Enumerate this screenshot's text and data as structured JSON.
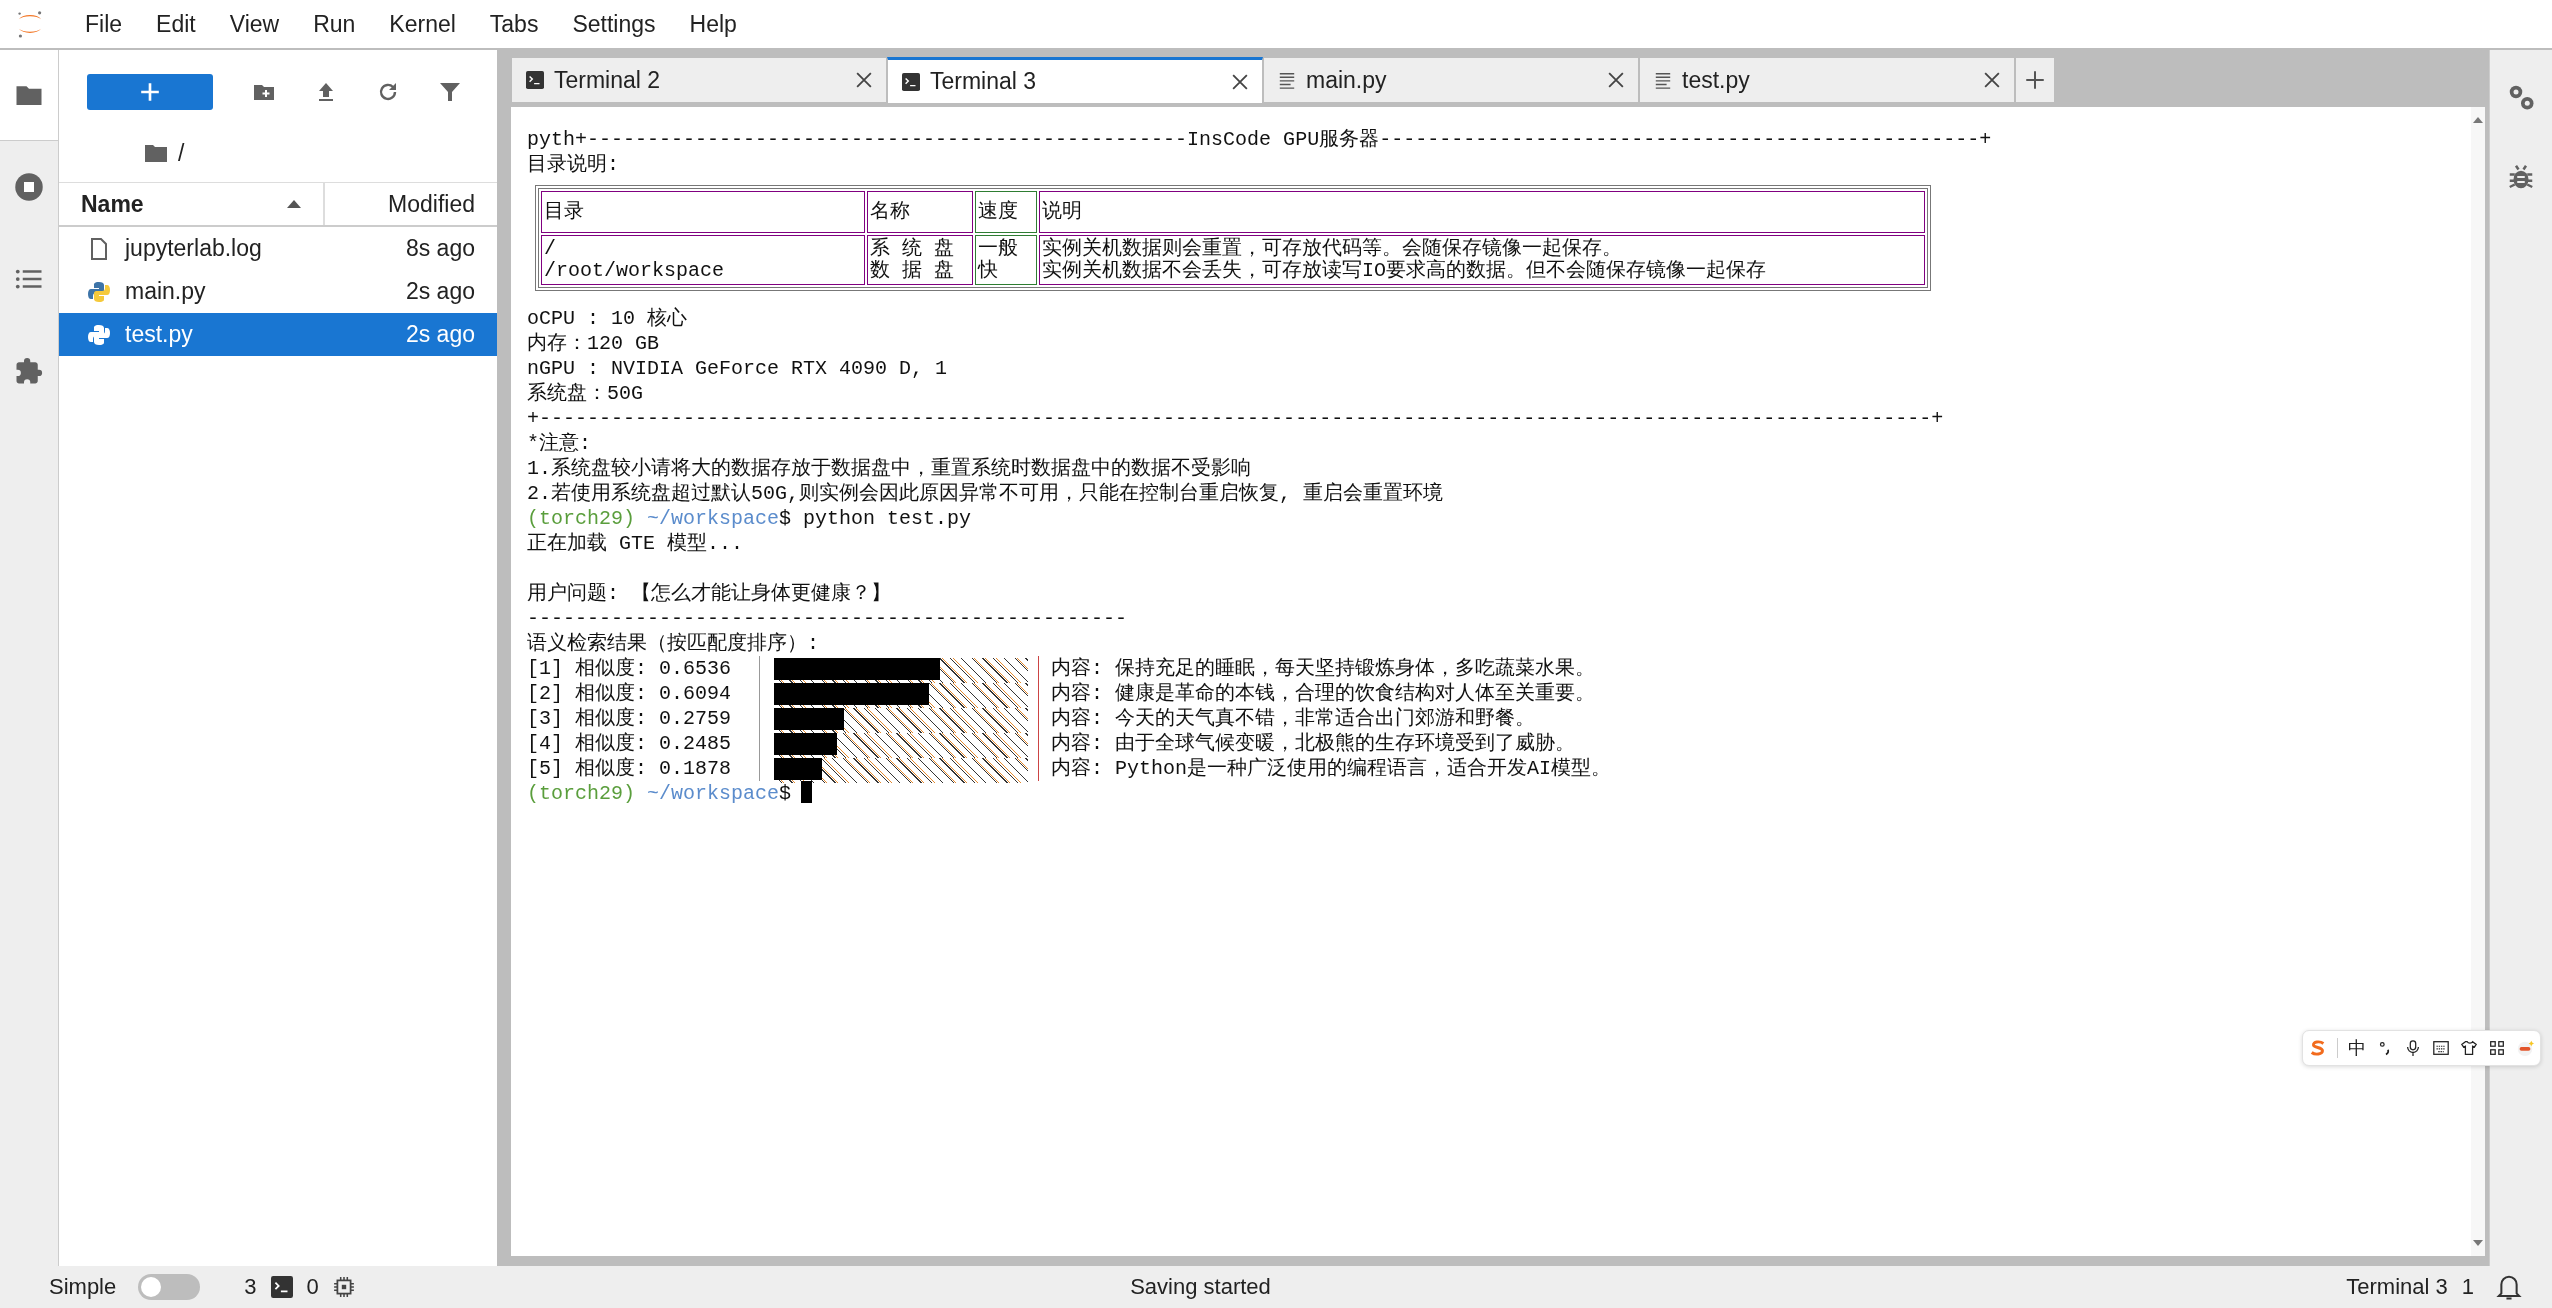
{
  "menu": [
    "File",
    "Edit",
    "View",
    "Run",
    "Kernel",
    "Tabs",
    "Settings",
    "Help"
  ],
  "activity": [
    {
      "kind": "folder",
      "selected": true
    },
    {
      "kind": "stop",
      "selected": false
    },
    {
      "kind": "list",
      "selected": false
    },
    {
      "kind": "puzzle",
      "selected": false
    }
  ],
  "file_browser": {
    "breadcrumb": "/",
    "columns": {
      "name": "Name",
      "modified": "Modified"
    },
    "files": [
      {
        "kind": "log",
        "name": "jupyterlab.log",
        "modified": "8s ago",
        "selected": false
      },
      {
        "kind": "python",
        "name": "main.py",
        "modified": "2s ago",
        "selected": false
      },
      {
        "kind": "python",
        "name": "test.py",
        "modified": "2s ago",
        "selected": true
      }
    ]
  },
  "tabs": [
    {
      "kind": "terminal",
      "label": "Terminal 2",
      "selected": false
    },
    {
      "kind": "terminal",
      "label": "Terminal 3",
      "selected": true
    },
    {
      "kind": "file",
      "label": "main.py",
      "selected": false
    },
    {
      "kind": "file",
      "label": "test.py",
      "selected": false
    }
  ],
  "terminal": {
    "lines": [
      {
        "kind": "text",
        "text": "pyth+--------------------------------------------------InsCode GPU服务器--------------------------------------------------+"
      },
      {
        "kind": "text",
        "text": "目录说明:"
      },
      {
        "kind": "table",
        "columns": [
          "目录",
          "名称",
          "速度",
          "说明"
        ],
        "rows": [
          [
            [
              "/",
              "/root/workspace"
            ],
            [
              "系 统 盘",
              "数 据 盘"
            ],
            [
              "一般",
              "快"
            ],
            [
              "实例关机数据则会重置，可存放代码等。会随保存镜像一起保存。",
              "实例关机数据不会丢失，可存放读写IO要求高的数据。但不会随保存镜像一起保存"
            ]
          ]
        ]
      },
      {
        "kind": "text",
        "text": "oCPU : 10 核心"
      },
      {
        "kind": "text",
        "text": "内存：120 GB"
      },
      {
        "kind": "text",
        "text": "nGPU : NVIDIA GeForce RTX 4090 D, 1"
      },
      {
        "kind": "text",
        "text": "系统盘：50G"
      },
      {
        "kind": "text",
        "text": "+--------------------------------------------------------------------------------------------------------------------+"
      },
      {
        "kind": "text",
        "text": "*注意:"
      },
      {
        "kind": "text",
        "text": "1.系统盘较小请将大的数据存放于数据盘中，重置系统时数据盘中的数据不受影响"
      },
      {
        "kind": "text",
        "text": "2.若使用系统盘超过默认50G,则实例会因此原因异常不可用，只能在控制台重启恢复, 重启会重置环境"
      },
      {
        "kind": "prompt",
        "env": "(torch29)",
        "path": "~/workspace",
        "command": "$ python test.py",
        "cursor": false
      },
      {
        "kind": "text",
        "text": "正在加载 GTE 模型..."
      },
      {
        "kind": "blank"
      },
      {
        "kind": "text",
        "text": "用户问题: 【怎么才能让身体更健康？】"
      },
      {
        "kind": "text",
        "text": "--------------------------------------------------"
      },
      {
        "kind": "text",
        "text": "语义检索结果（按匹配度排序）:"
      },
      {
        "kind": "result",
        "label": "[1] 相似度: 0.6536",
        "level": 0.6536,
        "content": "内容: 保持充足的睡眠，每天坚持锻炼身体，多吃蔬菜水果。"
      },
      {
        "kind": "result",
        "label": "[2] 相似度: 0.6094",
        "level": 0.6094,
        "content": "内容: 健康是革命的本钱，合理的饮食结构对人体至关重要。"
      },
      {
        "kind": "result",
        "label": "[3] 相似度: 0.2759",
        "level": 0.2759,
        "content": "内容: 今天的天气真不错，非常适合出门郊游和野餐。"
      },
      {
        "kind": "result",
        "label": "[4] 相似度: 0.2485",
        "level": 0.2485,
        "content": "内容: 由于全球气候变暖，北极熊的生存环境受到了威胁。"
      },
      {
        "kind": "result",
        "label": "[5] 相似度: 0.1878",
        "level": 0.1878,
        "content": "内容: Python是一种广泛使用的编程语言，适合开发AI模型。"
      },
      {
        "kind": "prompt",
        "env": "(torch29)",
        "path": "~/workspace",
        "command": "$",
        "cursor": true
      }
    ]
  },
  "ime": {
    "mode": "中"
  },
  "status_bar": {
    "mode_label": "Simple",
    "simple_on": false,
    "terminals": "3",
    "kernels": "0",
    "message": "Saving started",
    "active": "Terminal 3",
    "notifications": "1"
  }
}
